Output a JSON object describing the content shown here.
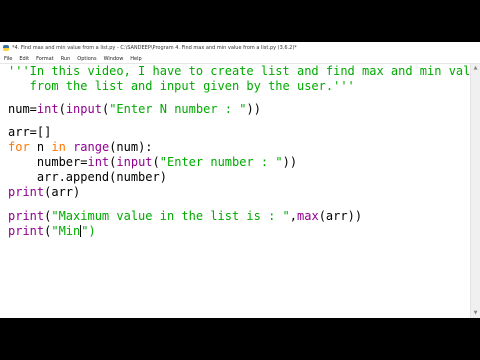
{
  "window": {
    "title": "*4. Find max and min value from a list.py - C:\\SANDEEP\\Program 4. Find max and min value from a list.py (3.6.2)*"
  },
  "menu": {
    "items": [
      "File",
      "Edit",
      "Format",
      "Run",
      "Options",
      "Window",
      "Help"
    ]
  },
  "code": {
    "line1_a": "'''In this video, I have to create list and find max and min value",
    "line2_a": "   from the list and input given by the user.'''",
    "line3_a": "num=",
    "line3_b": "int",
    "line3_c": "(",
    "line3_d": "input",
    "line3_e": "(",
    "line3_f": "\"Enter N number : \"",
    "line3_g": "))",
    "line4_a": "arr=[]",
    "line5_a": "for",
    "line5_b": " n ",
    "line5_c": "in",
    "line5_d": " ",
    "line5_e": "range",
    "line5_f": "(num):",
    "line6_a": "    number=",
    "line6_b": "int",
    "line6_c": "(",
    "line6_d": "input",
    "line6_e": "(",
    "line6_f": "\"Enter number : \"",
    "line6_g": "))",
    "line7_a": "    arr.append(number)",
    "line8_a": "print",
    "line8_b": "(arr)",
    "line9_a": "print",
    "line9_b": "(",
    "line9_c": "\"Maximum value in the list is : \"",
    "line9_d": ",",
    "line9_e": "max",
    "line9_f": "(arr))",
    "line10_a": "print",
    "line10_b": "(",
    "line10_c": "\"Min",
    "line10_d": "\")"
  },
  "colors": {
    "keyword": "#ff7700",
    "builtin": "#900090",
    "string": "#00aa00"
  }
}
